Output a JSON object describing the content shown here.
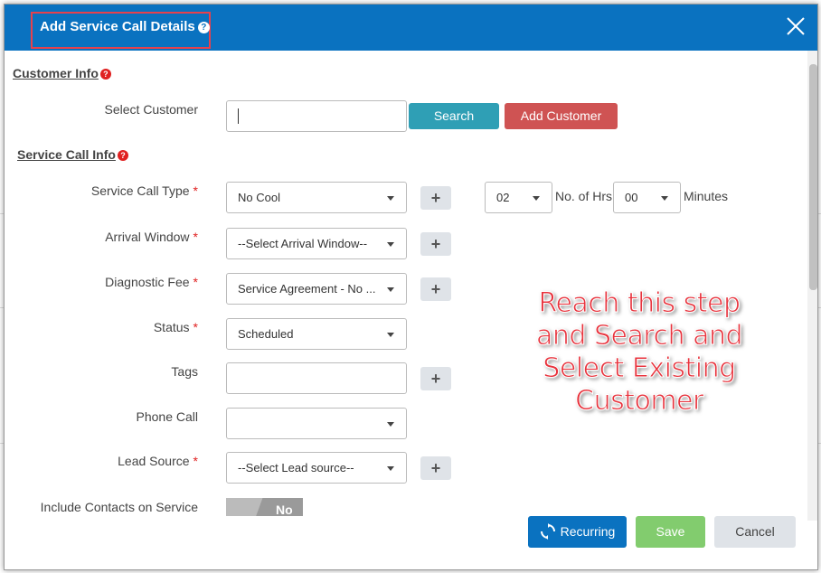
{
  "modal": {
    "title": "Add Service Call Details",
    "help": "?"
  },
  "customer_info": {
    "heading": "Customer Info",
    "help": "?",
    "select_customer_label": "Select Customer",
    "search_value": "",
    "search_button": "Search",
    "add_customer_button": "Add Customer"
  },
  "service_call_info": {
    "heading": "Service Call Info",
    "help": "?"
  },
  "form": {
    "required_mark": "*",
    "service_call_type": {
      "label": "Service Call Type",
      "value": "No Cool"
    },
    "hours": {
      "value": "02",
      "label": "No. of Hrs"
    },
    "minutes": {
      "value": "00",
      "label": "Minutes"
    },
    "arrival_window": {
      "label": "Arrival Window",
      "value": "--Select Arrival Window--"
    },
    "diagnostic_fee": {
      "label": "Diagnostic Fee",
      "value": "Service Agreement - No ..."
    },
    "status": {
      "label": "Status",
      "value": "Scheduled"
    },
    "tags": {
      "label": "Tags",
      "value": ""
    },
    "phone_call": {
      "label": "Phone Call",
      "value": ""
    },
    "lead_source": {
      "label": "Lead Source",
      "value": "--Select Lead source--"
    },
    "include_contacts": {
      "label": "Include Contacts on Service",
      "toggle": "No"
    },
    "plus": "+"
  },
  "footer": {
    "recurring": "Recurring",
    "save": "Save",
    "cancel": "Cancel"
  },
  "annotation": {
    "line1": "Reach this step",
    "line2": "and Search and",
    "line3": "Select Existing",
    "line4": "Customer"
  },
  "colors": {
    "header": "#0a72c0",
    "search": "#2f9fb5",
    "add_customer": "#cf5353",
    "recurring": "#0a72c0",
    "save": "#82cc6e",
    "cancel": "#dfe3e8",
    "annotation": "#e8333d"
  },
  "icons": {
    "close": "close-icon",
    "recurring": "refresh-icon"
  }
}
